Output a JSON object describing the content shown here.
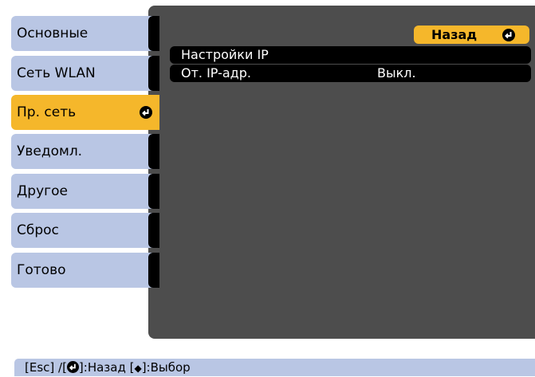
{
  "sidebar": {
    "items": [
      {
        "label": "Основные"
      },
      {
        "label": "Сеть WLAN"
      },
      {
        "label": "Пр. сеть"
      },
      {
        "label": "Уведомл."
      },
      {
        "label": "Другое"
      },
      {
        "label": "Сброс"
      },
      {
        "label": "Готово"
      }
    ],
    "selected_index": 2
  },
  "main": {
    "back_button": {
      "label": "Назад"
    },
    "rows": [
      {
        "label": "Настройки IP",
        "value": ""
      },
      {
        "label": "От. IP-адр.",
        "value": "Выкл."
      }
    ]
  },
  "footer": {
    "esc_part": "[Esc] /[",
    "back_part": "]:Назад   [",
    "select_part": "]:Выбор",
    "updown_glyph": "◆"
  },
  "colors": {
    "panel_bg": "#4d4d4d",
    "tab_bg": "#b9c6e4",
    "selected_bg": "#f5b72b",
    "row_bg": "#000000"
  }
}
